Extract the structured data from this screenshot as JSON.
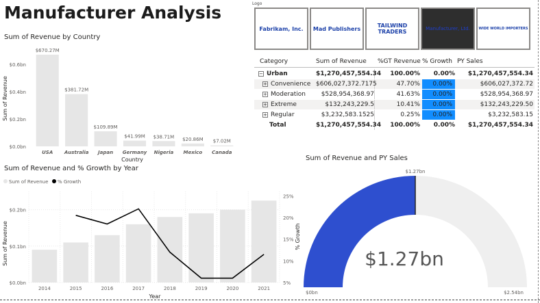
{
  "title": "Manufacturer Analysis",
  "logo_slicer": {
    "label": "Logo",
    "tiles": [
      {
        "name": "Fabrikam, Inc.",
        "color": "#1a3fa8",
        "selected": false
      },
      {
        "name": "Mad Publishers",
        "color": "#1a3fa8",
        "selected": false
      },
      {
        "name": "TAILWIND TRADERS",
        "color": "#1a3fa8",
        "selected": false
      },
      {
        "name": "Manufacturer, Ltd.",
        "color": "#1e3fd0",
        "selected": true
      },
      {
        "name": "WIDE WORLD IMPORTERS",
        "color": "#1a3fa8",
        "selected": false
      }
    ]
  },
  "matrix": {
    "headers": [
      "Category",
      "Sum of Revenue",
      "%GT Revenue",
      "% Growth",
      "PY Sales"
    ],
    "rows": [
      {
        "label": "Urban",
        "expander": "−",
        "bold": true,
        "revenue": "$1,270,457,554.34",
        "gt": "100.00%",
        "growth": "0.00%",
        "py": "$1,270,457,554.34"
      },
      {
        "label": "Convenience",
        "expander": "+",
        "bold": false,
        "revenue": "$606,027,372.7175",
        "gt": "47.70%",
        "growth": "0.00%",
        "py": "$606,027,372.72"
      },
      {
        "label": "Moderation",
        "expander": "+",
        "bold": false,
        "revenue": "$528,954,368.97",
        "gt": "41.63%",
        "growth": "0.00%",
        "py": "$528,954,368.97"
      },
      {
        "label": "Extreme",
        "expander": "+",
        "bold": false,
        "revenue": "$132,243,229.5",
        "gt": "10.41%",
        "growth": "0.00%",
        "py": "$132,243,229.50"
      },
      {
        "label": "Regular",
        "expander": "+",
        "bold": false,
        "revenue": "$3,232,583.1525",
        "gt": "0.25%",
        "growth": "0.00%",
        "py": "$3,232,583.15"
      }
    ],
    "total": {
      "label": "Total",
      "revenue": "$1,270,457,554.34",
      "gt": "100.00%",
      "growth": "0.00%",
      "py": "$1,270,457,554.34"
    }
  },
  "chart_data": [
    {
      "type": "bar",
      "title": "Sum of Revenue by Country",
      "xlabel": "Country",
      "ylabel": "Sum of Revenue",
      "categories": [
        "USA",
        "Australia",
        "Japan",
        "Germany",
        "Nigeria",
        "Mexico",
        "Canada"
      ],
      "values": [
        670.27,
        381.72,
        109.89,
        41.99,
        38.71,
        20.86,
        7.02
      ],
      "data_labels": [
        "$670.27M",
        "$381.72M",
        "$109.89M",
        "$41.99M",
        "$38.71M",
        "$20.86M",
        "$7.02M"
      ],
      "y_ticks": [
        "$0.0bn",
        "$0.2bn",
        "$0.4bn",
        "$0.6bn"
      ],
      "ylim": [
        0,
        700
      ],
      "bar_color": "#e6e6e6"
    },
    {
      "type": "bar+line",
      "title": "Sum of Revenue and % Growth by Year",
      "xlabel": "Year",
      "ylabel": "Sum of Revenue",
      "y2label": "% Growth",
      "legend": [
        "Sum of Revenue",
        "% Growth"
      ],
      "categories": [
        "2014",
        "2015",
        "2016",
        "2017",
        "2018",
        "2019",
        "2020",
        "2021"
      ],
      "series": [
        {
          "name": "Sum of Revenue",
          "values": [
            0.09,
            0.11,
            0.13,
            0.16,
            0.18,
            0.19,
            0.2,
            0.225
          ],
          "color": "#e6e6e6"
        },
        {
          "name": "% Growth",
          "values": [
            null,
            20.5,
            18.5,
            22,
            12,
            6,
            6,
            11.5
          ],
          "color": "#000000"
        }
      ],
      "y_ticks": [
        "$0.0bn",
        "$0.1bn",
        "$0.2bn"
      ],
      "ylim": [
        0,
        0.25
      ],
      "y2_ticks": [
        "5%",
        "10%",
        "15%",
        "20%",
        "25%"
      ],
      "y2lim": [
        5,
        26
      ]
    },
    {
      "type": "gauge",
      "title": "Sum of Revenue and PY Sales",
      "value": 1.27,
      "value_label": "$1.27bn",
      "target_label": "$1.27bn",
      "min_label": "$0bn",
      "max_label": "$2.54bn",
      "max": 2.54,
      "fill_color": "#2e4fcf",
      "track_color": "#efefef"
    }
  ]
}
